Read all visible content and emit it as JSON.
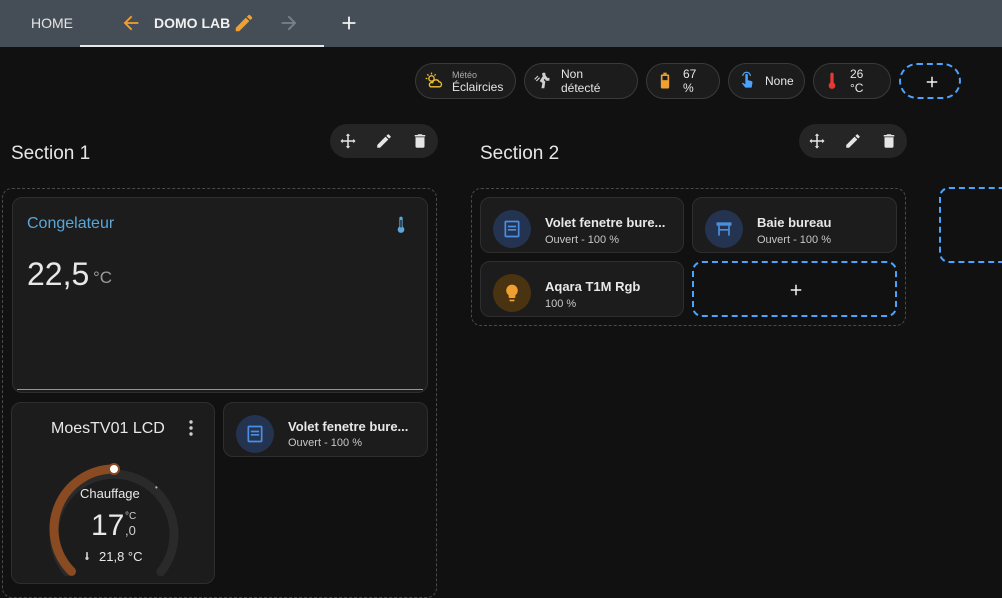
{
  "topbar": {
    "home_label": "HOME",
    "dashboard_label": "DOMO LAB",
    "icons": [
      "arrow-left-icon",
      "pencil-icon",
      "arrow-right-icon",
      "plus-icon"
    ]
  },
  "badges": [
    {
      "name": "meteo",
      "label": "Météo",
      "value": "Éclaircies",
      "icon": "partly-sunny-icon"
    },
    {
      "name": "presence",
      "value": "Non détecté",
      "icon": "motion-sensor-icon"
    },
    {
      "name": "battery",
      "value": "67 %",
      "icon": "battery-icon"
    },
    {
      "name": "touch",
      "value": "None",
      "icon": "gesture-tap-icon"
    },
    {
      "name": "temperature",
      "value": "26 °C",
      "icon": "thermometer-icon"
    }
  ],
  "sections": [
    {
      "title": "Section 1"
    },
    {
      "title": "Section 2"
    }
  ],
  "sensor_card": {
    "name": "Congelateur",
    "value": "22,5",
    "unit": "°C",
    "accent": "#5aa6d6"
  },
  "thermostat": {
    "name": "MoesTV01 LCD",
    "mode": "Chauffage",
    "target_integer": "17",
    "target_decimal": ",0",
    "target_unit": "°C",
    "current": "21,8 °C",
    "target_fraction": 0.5
  },
  "tiles_section1": [
    {
      "name": "Volet fenetre bure...",
      "state": "Ouvert - 100 %",
      "icon": "window-shutter-icon"
    }
  ],
  "tiles_section2": [
    {
      "name": "Volet fenetre bure...",
      "state": "Ouvert - 100 %",
      "icon": "window-shutter-icon"
    },
    {
      "name": "Baie bureau",
      "state": "Ouvert - 100 %",
      "icon": "awning-icon"
    },
    {
      "name": "Aqara T1M Rgb",
      "state": "100 %",
      "icon": "lightbulb-icon"
    }
  ],
  "colors": {
    "topbar": "#454e56",
    "accent_orange": "#f0a030",
    "accent_blue": "#4aa3ff",
    "heating": "#8a4a22"
  }
}
